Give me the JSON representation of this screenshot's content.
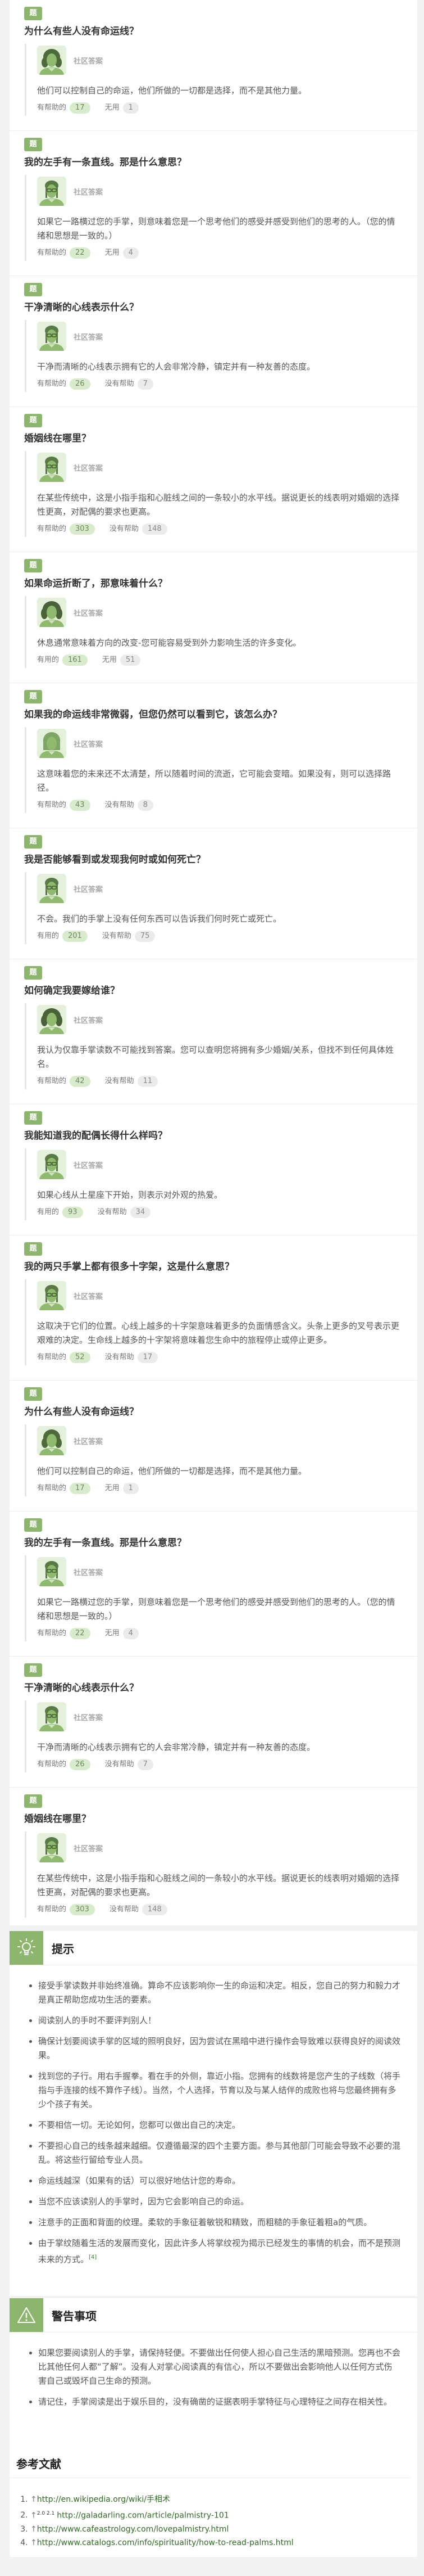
{
  "qa": {
    "badge_label": "题",
    "author_label": "社区答案",
    "items": [
      {
        "title": "为什么有些人没有命运线？",
        "answer": "他们可以控制自己的命运，他们所做的一切都是选择，而不是其他力量。",
        "helpful_label": "有帮助的",
        "helpful_count": "17",
        "unhelpful_label": "无用",
        "unhelpful_count": "1",
        "avatar": "curly-dark"
      },
      {
        "title": "我的左手有一条直线。那是什么意思？",
        "answer": "如果它一路横过您的手掌，则意味着您是一个思考他们的感受并感受到他们的思考的人。（您的情绪和思想是一致的。）",
        "helpful_label": "有帮助的",
        "helpful_count": "22",
        "unhelpful_label": "无用",
        "unhelpful_count": "4",
        "avatar": "glasses"
      },
      {
        "title": "干净清晰的心线表示什么？",
        "answer": "干净而清晰的心线表示拥有它的人会非常冷静，镇定并有一种友善的态度。",
        "helpful_label": "有帮助的",
        "helpful_count": "26",
        "unhelpful_label": "没有帮助",
        "unhelpful_count": "7",
        "avatar": "glasses"
      },
      {
        "title": "婚姻线在哪里？",
        "answer": "在某些传统中，这是小指手指和心脏线之间的一条较小的水平线。据说更长的线表明对婚姻的选择性更高，对配偶的要求也更高。",
        "helpful_label": "有帮助的",
        "helpful_count": "303",
        "unhelpful_label": "没有帮助",
        "unhelpful_count": "148",
        "avatar": "glasses"
      },
      {
        "title": "如果命运折断了，那意味着什么？",
        "answer": "休息通常意味着方向的改变-您可能容易受到外力影响生活的许多变化。",
        "helpful_label": "有用的",
        "helpful_count": "161",
        "unhelpful_label": "无用",
        "unhelpful_count": "51",
        "avatar": "curly"
      },
      {
        "title": "如果我的命运线非常微弱，但您仍然可以看到它，该怎么办？",
        "answer": "这意味着您的未来还不太清楚，所以随着时间的流逝，它可能会变暗。如果没有，则可以选择路径。",
        "helpful_label": "有帮助的",
        "helpful_count": "43",
        "unhelpful_label": "没有帮助",
        "unhelpful_count": "8",
        "avatar": "long-hair"
      },
      {
        "title": "我是否能够看到或发现我何时或如何死亡？",
        "answer": "不会。我们的手掌上没有任何东西可以告诉我们何时死亡或死亡。",
        "helpful_label": "有用的",
        "helpful_count": "201",
        "unhelpful_label": "没有帮助",
        "unhelpful_count": "75",
        "avatar": "glasses"
      },
      {
        "title": "如何确定我要嫁给谁？",
        "answer": "我认为仅靠手掌读数不可能找到答案。您可以查明您将拥有多少婚姻/关系，但找不到任何具体姓名。",
        "helpful_label": "有帮助的",
        "helpful_count": "42",
        "unhelpful_label": "没有帮助",
        "unhelpful_count": "11",
        "avatar": "curly"
      },
      {
        "title": "我能知道我的配偶长得什么样吗？",
        "answer": "如果心线从土星座下开始，则表示对外观的热爱。",
        "helpful_label": "有用的",
        "helpful_count": "93",
        "unhelpful_label": "没有帮助",
        "unhelpful_count": "34",
        "avatar": "glasses"
      },
      {
        "title": "我的两只手掌上都有很多十字架，这是什么意思？",
        "answer": "这取决于它们的位置。心线上越多的十字架意味着更多的负面情感含义。头条上更多的叉号表示更艰难的决定。生命线上越多的十字架将意味着您生命中的旅程停止或停止更多。",
        "helpful_label": "有帮助的",
        "helpful_count": "52",
        "unhelpful_label": "没有帮助",
        "unhelpful_count": "17",
        "avatar": "glasses"
      },
      {
        "title": "为什么有些人没有命运线？",
        "answer": "他们可以控制自己的命运，他们所做的一切都是选择，而不是其他力量。",
        "helpful_label": "有帮助的",
        "helpful_count": "17",
        "unhelpful_label": "无用",
        "unhelpful_count": "1",
        "avatar": "curly-dark"
      },
      {
        "title": "我的左手有一条直线。那是什么意思？",
        "answer": "如果它一路横过您的手掌，则意味着您是一个思考他们的感受并感受到他们的思考的人。（您的情绪和思想是一致的。）",
        "helpful_label": "有帮助的",
        "helpful_count": "22",
        "unhelpful_label": "无用",
        "unhelpful_count": "4",
        "avatar": "glasses"
      },
      {
        "title": "干净清晰的心线表示什么？",
        "answer": "干净而清晰的心线表示拥有它的人会非常冷静，镇定并有一种友善的态度。",
        "helpful_label": "有帮助的",
        "helpful_count": "26",
        "unhelpful_label": "没有帮助",
        "unhelpful_count": "7",
        "avatar": "glasses"
      },
      {
        "title": "婚姻线在哪里？",
        "answer": "在某些传统中，这是小指手指和心脏线之间的一条较小的水平线。据说更长的线表明对婚姻的选择性更高，对配偶的要求也更高。",
        "helpful_label": "有帮助的",
        "helpful_count": "303",
        "unhelpful_label": "没有帮助",
        "unhelpful_count": "148",
        "avatar": "glasses"
      }
    ]
  },
  "tips": {
    "title": "提示",
    "icon": "lightbulb-icon",
    "items": [
      "接受手掌读数并非始终准确。算命不应该影响你一生的命运和决定。相反，您自己的努力和毅力才是真正帮助您成功生活的要素。",
      "阅读别人的手时不要评判别人！",
      "确保计划要阅读手掌的区域的照明良好，因为尝试在黑暗中进行操作会导致难以获得良好的阅读效果。",
      "找到您的子行。用右手握拳。看在手的外侧，靠近小指。您拥有的线数将是您产生的子线数（将手指与手连接的线不算作子线）。当然，个人选择，节育以及与某人结伴的成败也将与您最终拥有多少个孩子有关。",
      "不要相信一切。无论如何，您都可以做出自己的决定。",
      "不要担心自己的线条越来越细。仅遵循最深的四个主要方面。参与其他部门可能会导致不必要的混乱。将这些行留给专业人员。",
      "命运线越深（如果有的话）可以很好地估计您的寿命。",
      "当您不应该读别人的手掌时，因为它会影响自己的命运。",
      "注意手的正面和背面的纹理。柔软的手象征着敏锐和精致，而粗糙的手象征着粗a的气质。",
      "由于掌纹随着生活的发展而变化，因此许多人将掌纹视为揭示已经发生的事情的机会，而不是预测未来的方式。"
    ],
    "last_citation": "[4]"
  },
  "warnings": {
    "title": "警告事项",
    "icon": "warning-icon",
    "items": [
      "如果您要阅读别人的手掌，请保持轻便。不要做出任何使人担心自己生活的黑暗预测。您再也不会比其他任何人都“了解”。没有人对掌心阅读真的有信心，所以不要做出会影响他人以任何方式伤害自己或毁坏自己生命的预测。",
      "请记住，手掌阅读是出于娱乐目的，没有确凿的证据表明手掌特征与心理特征之间存在相关性。"
    ]
  },
  "references": {
    "title": "参考文献",
    "arrow": "↑",
    "items": [
      {
        "sup": "",
        "url": "http://en.wikipedia.org/wiki/手相术"
      },
      {
        "sup": "2.0 2.1",
        "url": "http://galadarling.com/article/palmistry-101"
      },
      {
        "sup": "",
        "url": "http://www.cafeastrology.com/lovepalmistry.html"
      },
      {
        "sup": "",
        "url": "http://www.catalogs.com/info/spirituality/how-to-read-palms.html"
      }
    ]
  },
  "colors": {
    "accent": "#8cb56d",
    "link": "#2f6b23",
    "background": "#f2f2f2"
  }
}
